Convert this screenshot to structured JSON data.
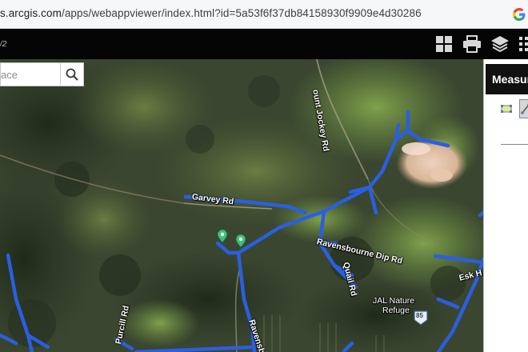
{
  "browser": {
    "url_host": "s.arcgis.com",
    "url_path": "/apps/webappviewer/index.html?id=5a53f6f37db84158930f9909e4d30286",
    "profile_icon": "google-g-icon"
  },
  "app": {
    "title_fragment": "/2",
    "tools": [
      {
        "name": "basemap-gallery-icon"
      },
      {
        "name": "print-icon"
      },
      {
        "name": "layer-list-icon"
      },
      {
        "name": "more-icon"
      }
    ]
  },
  "search": {
    "placeholder": "ace",
    "icon": "search-icon"
  },
  "map": {
    "road_labels": [
      "Garvey Rd",
      "Ravensbourne Dip Rd",
      "Quail Rd",
      "Esk H",
      "Purcill Rd",
      "Ravensbo",
      "ount Jockey Rd"
    ],
    "place_label_line1": "JAL Nature",
    "place_label_line2": "Refuge",
    "route_shield": "85",
    "marker_icon": "location-pin-icon",
    "network_color": "#2a5fe0"
  },
  "measurement": {
    "title": "Measur",
    "tools": [
      "area-measure-icon",
      "distance-measure-icon"
    ]
  }
}
